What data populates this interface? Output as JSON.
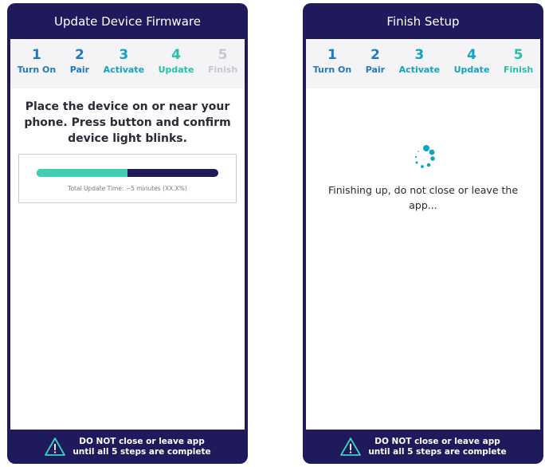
{
  "left_screen": {
    "title": "Update Device Firmware",
    "steps": [
      {
        "num": "1",
        "label": "Turn On"
      },
      {
        "num": "2",
        "label": "Pair"
      },
      {
        "num": "3",
        "label": "Activate"
      },
      {
        "num": "4",
        "label": "Update"
      },
      {
        "num": "5",
        "label": "Finish"
      }
    ],
    "instruction": "Place the device on or near your phone. Press button and confirm device light blinks.",
    "progress": {
      "fraction": 0.5,
      "text": "Total Update Time: ~5 minutes (XX.X%)"
    },
    "footer": {
      "line1": "DO NOT close or leave app",
      "line2": "until all 5 steps are complete"
    }
  },
  "right_screen": {
    "title": "Finish Setup",
    "steps": [
      {
        "num": "1",
        "label": "Turn On"
      },
      {
        "num": "2",
        "label": "Pair"
      },
      {
        "num": "3",
        "label": "Activate"
      },
      {
        "num": "4",
        "label": "Update"
      },
      {
        "num": "5",
        "label": "Finish"
      }
    ],
    "message": "Finishing up, do not close or leave the app...",
    "footer": {
      "line1": "DO NOT close or leave app",
      "line2": "until all 5 steps are complete"
    }
  },
  "colors": {
    "brand_navy": "#1f1a5c",
    "step_blue": "#2079c2",
    "step_teal": "#21c2a8",
    "step_inactive": "#c8c8cc",
    "progress_fill": "#3fd0b4"
  },
  "icons": {
    "warning": "warning-triangle-icon",
    "spinner": "loading-spinner-icon"
  }
}
